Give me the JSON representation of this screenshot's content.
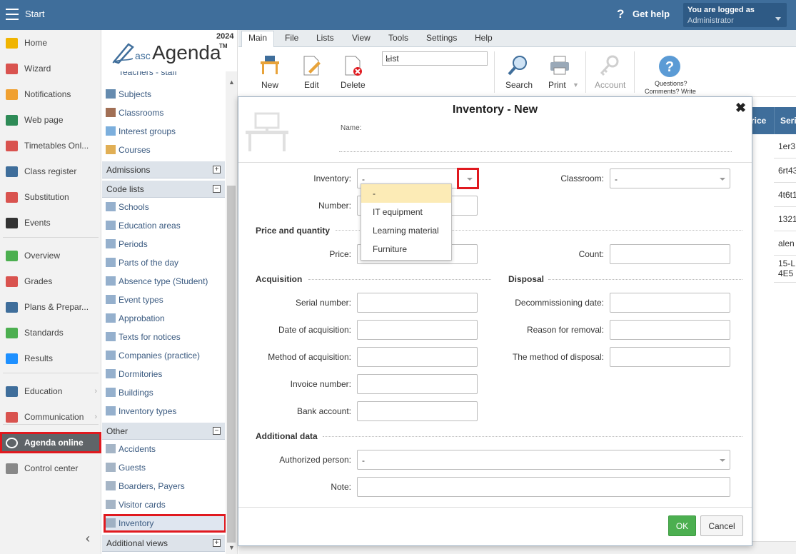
{
  "topbar": {
    "start": "Start",
    "help_q": "?",
    "get_help": "Get help",
    "logged_as": "You are logged as",
    "user": "Administrator"
  },
  "leftnav": [
    {
      "label": "Home",
      "icon": "star-icon",
      "color": "#f0b400"
    },
    {
      "label": "Wizard",
      "icon": "wand-icon",
      "color": "#d9534f"
    },
    {
      "label": "Notifications",
      "icon": "envelope-icon",
      "color": "#f0a030"
    },
    {
      "label": "Web page",
      "icon": "house-icon",
      "color": "#2e8b57"
    },
    {
      "label": "Timetables Onl...",
      "icon": "grid-icon",
      "color": "#d9534f"
    },
    {
      "label": "Class register",
      "icon": "book-icon",
      "color": "#3f6e9b"
    },
    {
      "label": "Substitution",
      "icon": "person-icon",
      "color": "#d9534f"
    },
    {
      "label": "Events",
      "icon": "calendar-icon",
      "color": "#333333"
    },
    {
      "label": "Overview",
      "icon": "check-circle-icon",
      "color": "#4caf50"
    },
    {
      "label": "Grades",
      "icon": "grades-icon",
      "color": "#d9534f"
    },
    {
      "label": "Plans & Prepar...",
      "icon": "briefcase-icon",
      "color": "#3f6e9b"
    },
    {
      "label": "Standards",
      "icon": "shield-check-icon",
      "color": "#4caf50"
    },
    {
      "label": "Results",
      "icon": "bar-chart-icon",
      "color": "#1e90ff"
    },
    {
      "label": "Education",
      "icon": "book-open-icon",
      "color": "#3f6e9b"
    },
    {
      "label": "Communication",
      "icon": "chat-icon",
      "color": "#d9534f"
    },
    {
      "label": "Agenda online",
      "icon": "agenda-icon",
      "color": "#ffffff"
    },
    {
      "label": "Control center",
      "icon": "gear-icon",
      "color": "#888888"
    }
  ],
  "logo": {
    "year": "2024",
    "asc": "asc",
    "agenda": "Agenda",
    "tm": "TM"
  },
  "tree": {
    "top_items": [
      "Teachers - staff",
      "Subjects",
      "Classrooms",
      "Interest groups",
      "Courses"
    ],
    "admissions": "Admissions",
    "code_lists": "Code lists",
    "code_items": [
      "Schools",
      "Education areas",
      "Periods",
      "Parts of the day",
      "Absence type (Student)",
      "Event types",
      "Approbation",
      "Texts for notices",
      "Companies (practice)",
      "Dormitories",
      "Buildings",
      "Inventory types"
    ],
    "other": "Other",
    "other_items": [
      "Accidents",
      "Guests",
      "Boarders, Payers",
      "Visitor cards",
      "Inventory"
    ],
    "additional_views": "Additional views",
    "plus": "+",
    "minus": "−"
  },
  "menu": [
    "Main",
    "File",
    "Lists",
    "View",
    "Tools",
    "Settings",
    "Help"
  ],
  "ribbon": {
    "new": "New",
    "edit": "Edit",
    "delete": "Delete",
    "list_value": "List",
    "search": "Search",
    "print": "Print",
    "account": "Account",
    "questions1": "Questions?",
    "questions2": "Comments? Write"
  },
  "grid": {
    "headers": [
      "rice",
      "Seri"
    ],
    "cells": [
      "1er3",
      "6rt43",
      "4t6t1",
      "1321",
      "alen",
      "15-L",
      "4E5"
    ]
  },
  "modal": {
    "title": "Inventory - New",
    "close": "✖",
    "name_label": "Name:",
    "inventory_label": "Inventory:",
    "inventory_value": "-",
    "classroom_label": "Classroom:",
    "classroom_value": "-",
    "number_label": "Number:",
    "sec_price": "Price and quantity",
    "price_label": "Price:",
    "count_label": "Count:",
    "sec_acq": "Acquisition",
    "sec_disp": "Disposal",
    "serial_label": "Serial number:",
    "date_acq_label": "Date of acquisition:",
    "method_acq_label": "Method of acquisition:",
    "invoice_label": "Invoice number:",
    "bank_label": "Bank account:",
    "decom_label": "Decommissioning date:",
    "reason_label": "Reason for removal:",
    "method_disp_label": "The method of disposal:",
    "sec_add": "Additional data",
    "auth_label": "Authorized person:",
    "auth_value": "-",
    "note_label": "Note:",
    "ok": "OK",
    "cancel": "Cancel"
  },
  "dropdown": [
    "-",
    "IT equipment",
    "Learning material",
    "Furniture"
  ],
  "colors": {
    "topbar": "#3f6e9b",
    "highlight": "#e0191f",
    "ok": "#4caf50",
    "dropdown_hl": "#fcebb6"
  }
}
